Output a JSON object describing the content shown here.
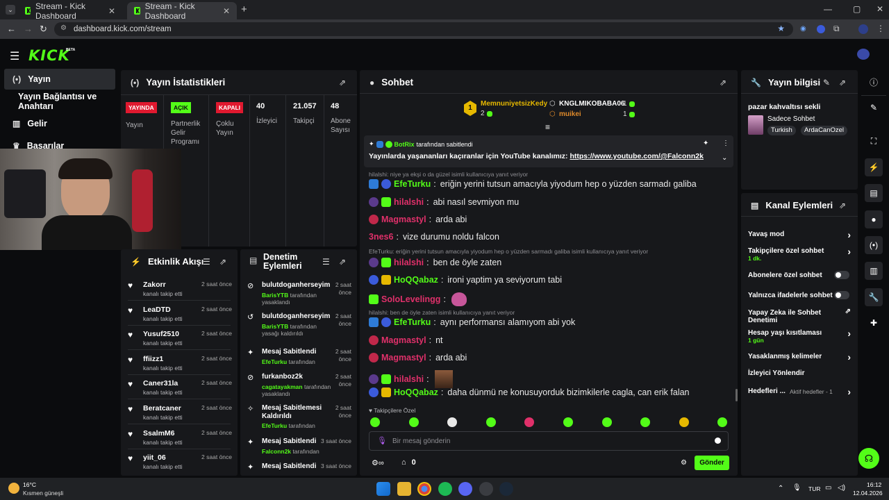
{
  "browser": {
    "tabs": [
      {
        "title": "Stream - Kick Dashboard"
      },
      {
        "title": "Stream - Kick Dashboard"
      }
    ],
    "url": "dashboard.kick.com/stream"
  },
  "brand": {
    "logo": "KICK",
    "beta": "BETA",
    "accent": "#53fc18"
  },
  "sidebar": {
    "items": [
      {
        "label": "Yayın",
        "icon": "broadcast-icon"
      },
      {
        "label": "Yayın Bağlantısı ve Anahtarı"
      },
      {
        "label": "Gelir",
        "icon": "chart-icon"
      },
      {
        "label": "Başarılar",
        "icon": "trophy-icon"
      }
    ]
  },
  "stats": {
    "title": "Yayın İstatistikleri",
    "cols": [
      {
        "badge": "YAYINDA",
        "label": "Yayın",
        "color": "#e0192f"
      },
      {
        "badge": "AÇIK",
        "label": "Partnerlik Gelir Programı",
        "color": "#53fc18"
      },
      {
        "badge": "KAPALI",
        "label": "Çoklu Yayın",
        "color": "#e0192f"
      },
      {
        "value": "40",
        "label": "İzleyici"
      },
      {
        "value": "21.057",
        "label": "Takipçi"
      },
      {
        "value": "48",
        "label": "Abone Sayısı"
      }
    ]
  },
  "activity": {
    "title": "Etkinlik Akışı",
    "items": [
      {
        "name": "Zakorr",
        "sub": "kanalı takip etti",
        "time": "2 saat önce"
      },
      {
        "name": "LeaDTD",
        "sub": "kanalı takip etti",
        "time": "2 saat önce"
      },
      {
        "name": "Yusuf2510",
        "sub": "kanalı takip etti",
        "time": "2 saat önce"
      },
      {
        "name": "ffiizz1",
        "sub": "kanalı takip etti",
        "time": "2 saat önce"
      },
      {
        "name": "Caner31la",
        "sub": "kanalı takip etti",
        "time": "2 saat önce"
      },
      {
        "name": "Beratcaner",
        "sub": "kanalı takip etti",
        "time": "2 saat önce"
      },
      {
        "name": "SsalmM6",
        "sub": "kanalı takip etti",
        "time": "2 saat önce"
      },
      {
        "name": "yiit_06",
        "sub": "kanalı takip etti",
        "time": "2 saat önce"
      }
    ]
  },
  "moderation": {
    "title": "Denetim Eylemleri",
    "items": [
      {
        "title": "bulutdoganherseyim",
        "by": "BarisYTB",
        "action": "tarafından yasaklandı",
        "time": "2 saat önce"
      },
      {
        "title": "bulutdoganherseyim",
        "by": "BarisYTB",
        "action": "tarafından yasağı kaldırıldı",
        "time": "2 saat önce"
      },
      {
        "title": "Mesaj Sabitlendi",
        "by": "EfeTurku",
        "action": "tarafından",
        "time": "2 saat önce"
      },
      {
        "title": "furkanboz2k",
        "by": "cagatayakman",
        "action": "tarafından yasaklandı",
        "time": "2 saat önce"
      },
      {
        "title": "Mesaj Sabitlemesi Kaldırıldı",
        "by": "EfeTurku",
        "action": "tarafından",
        "time": "2 saat önce"
      },
      {
        "title": "Mesaj Sabitlendi",
        "by": "Falconn2k",
        "action": "tarafından",
        "time": "3 saat önce"
      },
      {
        "title": "Mesaj Sabitlendi",
        "by": "",
        "action": "",
        "time": "3 saat önce"
      }
    ]
  },
  "chat": {
    "title": "Sohbet",
    "leaders": [
      {
        "rank": "1",
        "name": "MemnuniyetsizKedy",
        "count": "2"
      },
      {
        "name": "KNGLMIKOBABA06",
        "count": "1"
      },
      {
        "name": "muikei",
        "count": "1"
      }
    ],
    "pinned": {
      "author": "BotRix",
      "note": "tarafından sabitlendi",
      "text": "Yayınlarda yaşananları kaçıranlar için YouTube kanalımız:",
      "link": "https://www.youtube.com/@Falconn2k"
    },
    "messages": [
      {
        "reply": "hilalshi: niye ya ekşi o da güzel isimli kullanıcıya yanıt veriyor"
      },
      {
        "user": "EfeTurku",
        "color": "#53fc18",
        "text": "eriğin yerini tutsun amacıyla yiyodum hep o yüzden sarmadı galiba",
        "badges": [
          "b-blue",
          "b-circ"
        ]
      },
      {
        "user": "hilalshi",
        "color": "#e0306a",
        "text": "abi nasıl sevmiyon mu",
        "badges": [
          "b-pur",
          "b-gift"
        ]
      },
      {
        "user": "Magmastyl",
        "color": "#e0306a",
        "text": "arda abi",
        "badges": [
          "b-red"
        ]
      },
      {
        "user": "3nes6",
        "color": "#e0306a",
        "text": "vize durumu noldu falcon",
        "badges": []
      },
      {
        "reply": "EfeTurku: eriğin yerini tutsun amacıyla yiyodum hep o yüzden sarmadı galiba isimli kullanıcıya yanıt veriyor"
      },
      {
        "user": "hilalshi",
        "color": "#e0306a",
        "text": "ben de öyle zaten",
        "badges": [
          "b-pur",
          "b-gift"
        ]
      },
      {
        "user": "HoQQabaz",
        "color": "#53fc18",
        "text": "ironi yaptim ya seviyorum tabi",
        "badges": [
          "b-circ",
          "b-gold"
        ]
      },
      {
        "user": "SoloLevelingg",
        "color": "#e0306a",
        "text": "",
        "badges": [
          "b-gift"
        ],
        "emote": "poop"
      },
      {
        "reply": "hilalshi: ben de öyle zaten isimli kullanıcıya yanıt veriyor"
      },
      {
        "user": "EfeTurku",
        "color": "#53fc18",
        "text": "aynı performansı alamıyom abi yok",
        "badges": [
          "b-blue",
          "b-circ"
        ]
      },
      {
        "user": "Magmastyl",
        "color": "#e0306a",
        "text": "nt",
        "badges": [
          "b-red"
        ]
      },
      {
        "user": "Magmastyl",
        "color": "#e0306a",
        "text": "arda abi",
        "badges": [
          "b-red"
        ]
      },
      {
        "user": "hilalshi",
        "color": "#e0306a",
        "text": "",
        "badges": [
          "b-pur",
          "b-gift"
        ],
        "emote": "face"
      },
      {
        "user": "HoQQabaz",
        "color": "#53fc18",
        "text": "daha dünmü ne konusuyorduk bizimkilerle cagla, can erik falan",
        "badges": [
          "b-circ",
          "b-gold"
        ]
      }
    ],
    "emote_label": "Takipçilere Özel",
    "input_placeholder": "Bir mesaj gönderin",
    "points": "0",
    "send": "Gönder"
  },
  "stream_info": {
    "title": "Yayın bilgisi",
    "stream_title": "pazar kahvaltısı sekli",
    "category": "Sadece Sohbet",
    "tags": [
      "Turkish",
      "ArdaCanOzel"
    ]
  },
  "channel_actions": {
    "title": "Kanal Eylemleri",
    "items": [
      {
        "label": "Yavaş mod",
        "kind": "chevron"
      },
      {
        "label": "Takipçilere özel sohbet",
        "sub": "1 dk.",
        "kind": "chevron"
      },
      {
        "label": "Abonelere özel sohbet",
        "kind": "toggle"
      },
      {
        "label": "Yalnızca ifadelerle sohbet",
        "kind": "toggle"
      },
      {
        "label": "Yapay Zeka ile Sohbet Denetimi",
        "kind": "external"
      },
      {
        "label": "Hesap yaşı kısıtlaması",
        "sub": "1 gün",
        "kind": "chevron"
      },
      {
        "label": "Yasaklanmış kelimeler",
        "kind": "chevron"
      },
      {
        "label": "İzleyici Yönlendir",
        "kind": "none"
      },
      {
        "label": "Hedefleri ...",
        "sub": "Aktif hedefler - 1",
        "kind": "chevron"
      }
    ]
  },
  "taskbar": {
    "weather_temp": "16°C",
    "weather_desc": "Kısmen güneşli",
    "lang": "TUR",
    "time": "16:12",
    "date": "12.04.2026"
  }
}
